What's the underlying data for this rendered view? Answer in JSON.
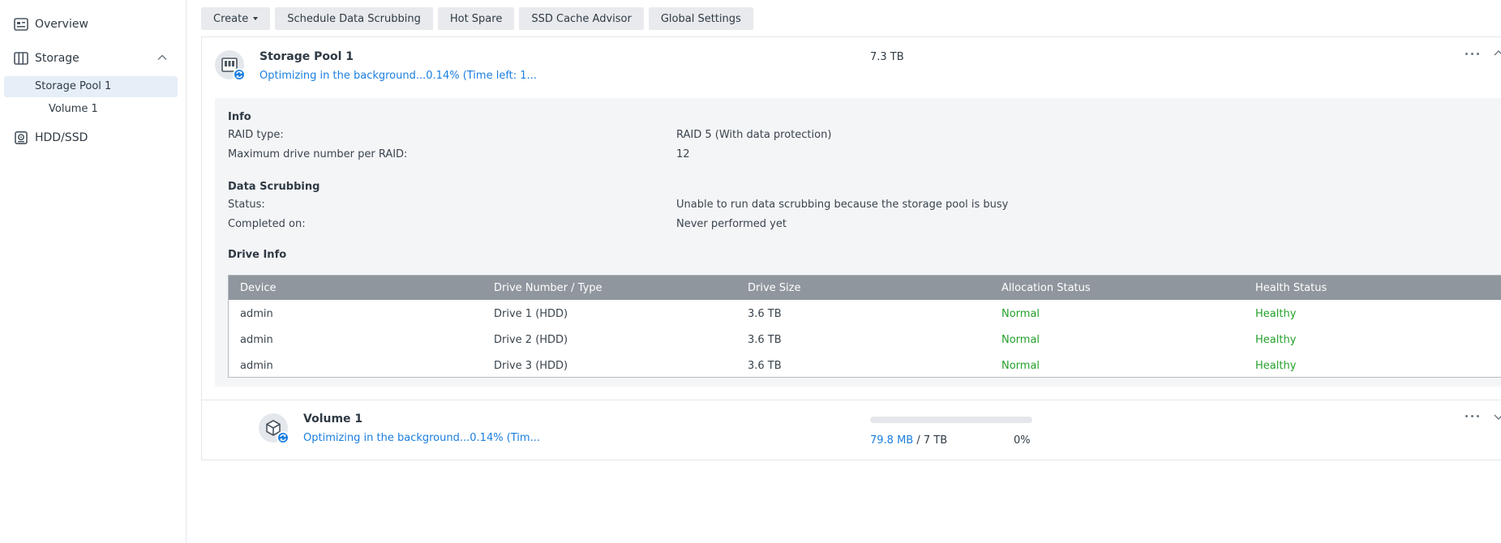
{
  "sidebar": {
    "overview": "Overview",
    "storage": "Storage",
    "storage_pool": "Storage Pool 1",
    "volume": "Volume 1",
    "hdd": "HDD/SSD"
  },
  "toolbar": {
    "create": "Create",
    "schedule": "Schedule Data Scrubbing",
    "hot_spare": "Hot Spare",
    "ssd_cache": "SSD Cache Advisor",
    "global_settings": "Global Settings"
  },
  "pool": {
    "title": "Storage Pool 1",
    "status": "Optimizing in the background...0.14% (Time left: 1...",
    "size": "7.3 TB",
    "info": {
      "heading": "Info",
      "raid_type_label": "RAID type:",
      "raid_type_value": "RAID 5 (With data protection)",
      "max_drive_label": "Maximum drive number per RAID:",
      "max_drive_value": "12"
    },
    "scrubbing": {
      "heading": "Data Scrubbing",
      "status_label": "Status:",
      "status_value": "Unable to run data scrubbing because the storage pool is busy",
      "completed_label": "Completed on:",
      "completed_value": "Never performed yet"
    },
    "drive_info": {
      "heading": "Drive Info",
      "columns": [
        "Device",
        "Drive Number / Type",
        "Drive Size",
        "Allocation Status",
        "Health Status"
      ],
      "rows": [
        [
          "admin",
          "Drive 1 (HDD)",
          "3.6 TB",
          "Normal",
          "Healthy"
        ],
        [
          "admin",
          "Drive 2 (HDD)",
          "3.6 TB",
          "Normal",
          "Healthy"
        ],
        [
          "admin",
          "Drive 3 (HDD)",
          "3.6 TB",
          "Normal",
          "Healthy"
        ]
      ]
    }
  },
  "volume": {
    "title": "Volume 1",
    "status": "Optimizing in the background...0.14% (Tim...",
    "used": "79.8 MB",
    "separator": "/",
    "total": "7 TB",
    "percent": "0%",
    "usage_fraction": 0.0
  },
  "colors": {
    "accent": "#1b7fe0",
    "healthy": "#24a12a",
    "table_header": "#8f969d",
    "selected_nav": "#e6eef8"
  },
  "icons": {
    "overview": "overview-icon",
    "storage": "storage-icon",
    "hdd": "hdd-icon",
    "pool": "storage-pool-icon",
    "volume": "volume-cube-icon",
    "sync": "sync-icon",
    "more": "more-horizontal-icon"
  }
}
